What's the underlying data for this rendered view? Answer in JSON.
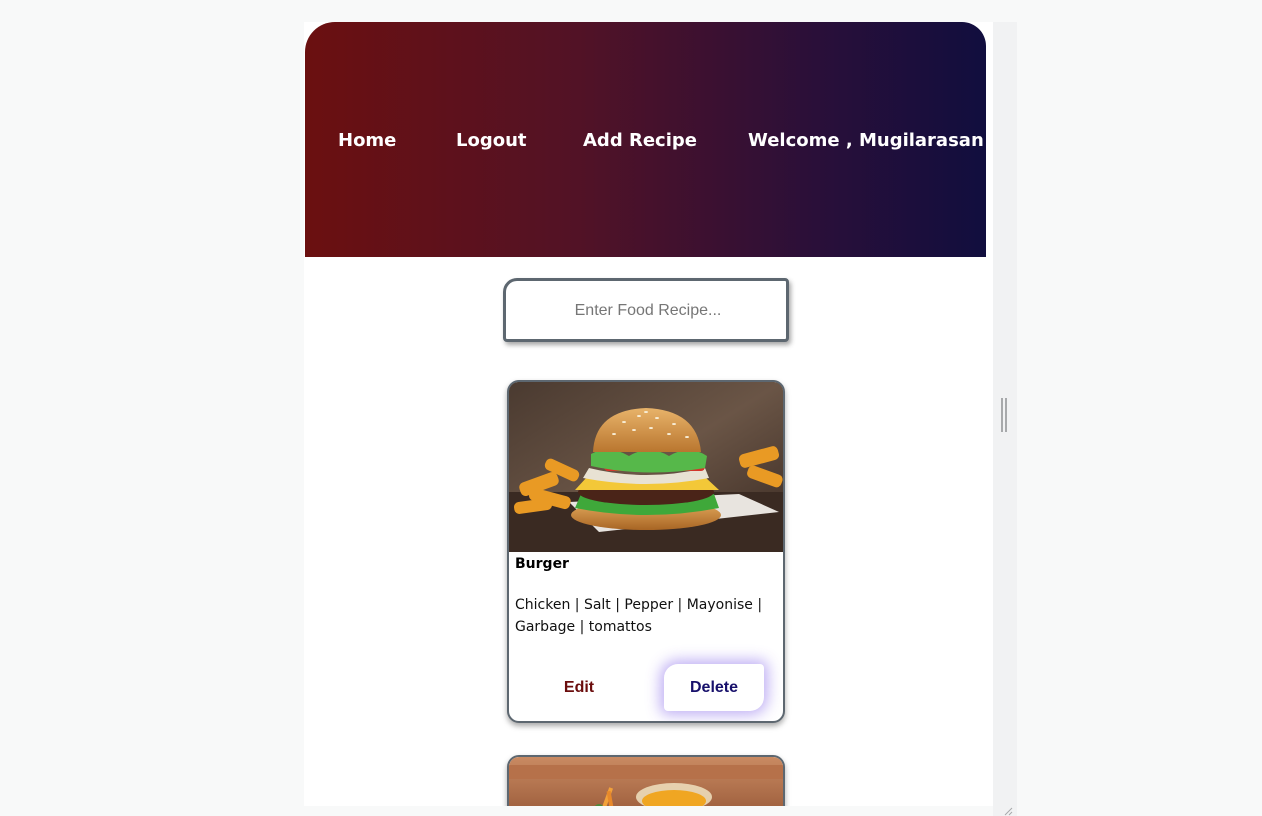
{
  "nav": {
    "home": "Home",
    "logout": "Logout",
    "add_recipe": "Add Recipe",
    "welcome": "Welcome , Mugilarasan"
  },
  "search": {
    "placeholder": "Enter Food Recipe...",
    "value": ""
  },
  "recipes": [
    {
      "title": "Burger",
      "ingredients": "Chicken | Salt | Pepper | Mayonise | Garbage | tomattos",
      "image": "burger-photo",
      "edit_label": "Edit",
      "delete_label": "Delete"
    },
    {
      "image": "food-photo"
    }
  ],
  "colors": {
    "header_gradient_start": "#6b1010",
    "header_gradient_end": "#110e3e",
    "edit_text": "#6b0d0d",
    "delete_text": "#17106b",
    "delete_glow": "#7350e6"
  }
}
